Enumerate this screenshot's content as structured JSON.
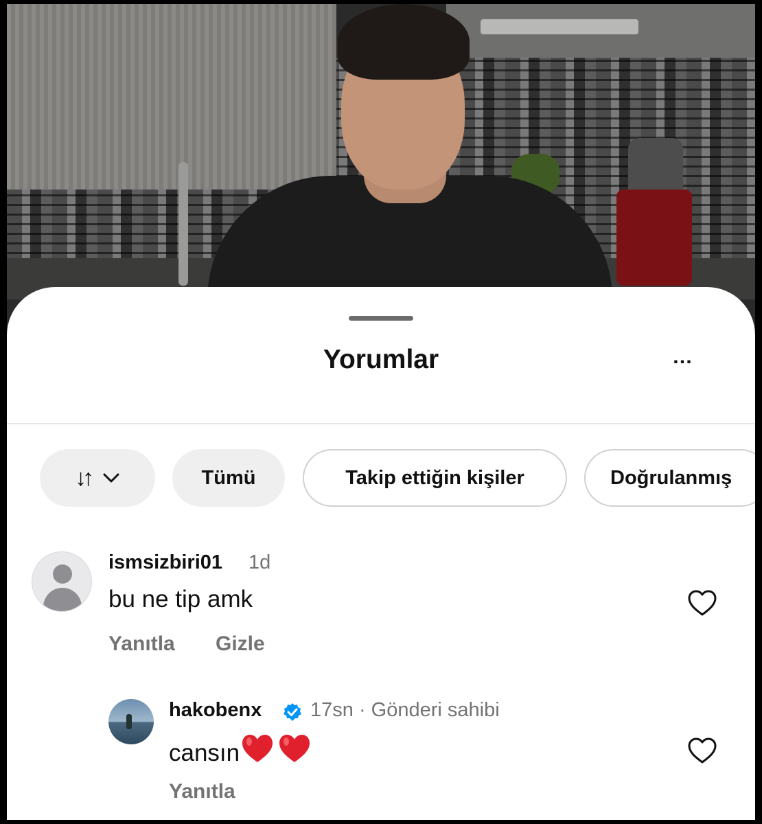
{
  "sheet": {
    "title": "Yorumlar",
    "more_icon": "…"
  },
  "filters": {
    "sort_label": "↓↑",
    "chips": [
      "Tümü",
      "Takip ettiğin kişiler",
      "Doğrulanmış"
    ]
  },
  "comments": [
    {
      "username": "ismsizbiri01",
      "time": "1d",
      "text": "bu ne tip amk",
      "actions": [
        "Yanıtla",
        "Gizle"
      ],
      "avatar": "default-avatar-icon",
      "liked": false
    },
    {
      "username": "hakobenx",
      "verified": true,
      "meta": "17sn · Gönderi sahibi",
      "text": "cansın",
      "emojis": "❤️ ❤️",
      "actions": [
        "Yanıtla"
      ],
      "avatar": "profile-photo",
      "liked": false
    }
  ],
  "colors": {
    "verified_blue": "#0095f6",
    "heart_red": "#e0202d",
    "secondary_text": "#737373"
  }
}
